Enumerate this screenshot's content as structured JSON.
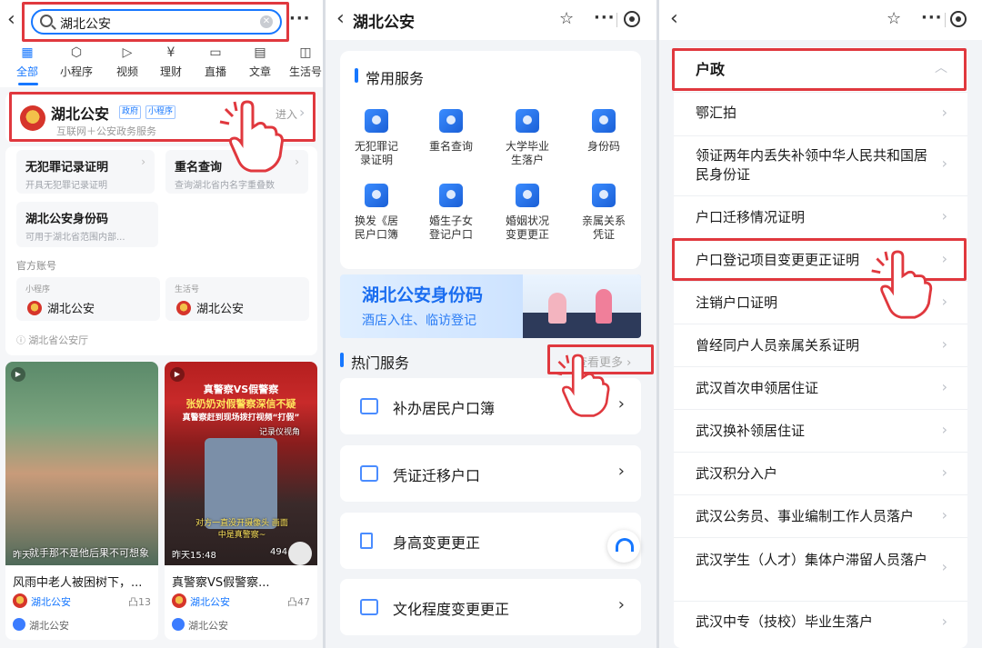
{
  "panel1": {
    "search_query": "湖北公安",
    "tabs": [
      {
        "label": "全部",
        "icon": "grid-icon",
        "glyph": "▦",
        "active": true
      },
      {
        "label": "小程序",
        "icon": "miniapp-icon",
        "glyph": "⬡"
      },
      {
        "label": "视频",
        "icon": "play-icon",
        "glyph": "▷"
      },
      {
        "label": "理财",
        "icon": "yen-icon",
        "glyph": "¥"
      },
      {
        "label": "直播",
        "icon": "tv-icon",
        "glyph": "▭"
      },
      {
        "label": "文章",
        "icon": "article-icon",
        "glyph": "▤"
      },
      {
        "label": "生活号",
        "icon": "life-icon",
        "glyph": "◫"
      }
    ],
    "result": {
      "title": "湖北公安",
      "badges": [
        "政府",
        "小程序"
      ],
      "subtitle": "互联网＋公安政务服务",
      "enter": "进入"
    },
    "services": [
      {
        "title": "无犯罪记录证明",
        "desc": "开具无犯罪记录证明"
      },
      {
        "title": "重名查询",
        "desc": "查询湖北省内名字重叠数"
      },
      {
        "title": "湖北公安身份码",
        "desc": "可用于湖北省范围内部..."
      }
    ],
    "official_label": "官方账号",
    "accounts": [
      {
        "kind": "小程序",
        "name": "湖北公安"
      },
      {
        "kind": "生活号",
        "name": "湖北公安"
      }
    ],
    "source": "湖北省公安厅",
    "videos": [
      {
        "time": "昨天",
        "overlay": "就手那不是他后果不可想象",
        "title": "风雨中老人被困树下，...",
        "author": "湖北公安",
        "likes": "13",
        "source": "湖北公安"
      },
      {
        "time": "昨天15:48",
        "overlay_top1": "真警察VS假警察",
        "overlay_top2": "张奶奶对假警察深信不疑",
        "overlay_top3": "真警察赶到现场拨打视频“打假”",
        "overlay_mid": "记录仪视角",
        "overlay_bot": "对方一直没开摄像头 画面中是真警察~",
        "views": "494",
        "title": "真警察VS假警察...",
        "author": "湖北公安",
        "likes": "47",
        "source": "湖北公安"
      }
    ]
  },
  "panel2": {
    "title": "湖北公安",
    "common_title": "常用服务",
    "services": [
      {
        "label": "无犯罪记录证明"
      },
      {
        "label": "重名查询"
      },
      {
        "label": "大学毕业生落户"
      },
      {
        "label": "身份码"
      },
      {
        "label": "换发《居民户口簿"
      },
      {
        "label": "婚生子女登记户口"
      },
      {
        "label": "婚姻状况变更更正"
      },
      {
        "label": "亲属关系凭证"
      }
    ],
    "banner": {
      "title": "湖北公安身份码",
      "subtitle": "酒店入住、临访登记"
    },
    "hot_title": "热门服务",
    "see_more": "查看更多",
    "hot_items": [
      {
        "label": "补办居民户口簿"
      },
      {
        "label": "凭证迁移户口"
      },
      {
        "label": "身高变更更正"
      },
      {
        "label": "文化程度变更更正"
      }
    ]
  },
  "panel3": {
    "group": "户政",
    "items": [
      "鄂汇拍",
      "领证两年内丢失补领中华人民共和国居民身份证",
      "户口迁移情况证明",
      "户口登记项目变更更正证明",
      "注销户口证明",
      "曾经同户人员亲属关系证明",
      "武汉首次申领居住证",
      "武汉换补领居住证",
      "武汉积分入户",
      "武汉公务员、事业编制工作人员落户",
      "武汉学生（人才）集体户滞留人员落户",
      "武汉中专（技校）毕业生落户"
    ]
  },
  "colors": {
    "accent": "#1677ff",
    "highlight": "#e0383e"
  }
}
